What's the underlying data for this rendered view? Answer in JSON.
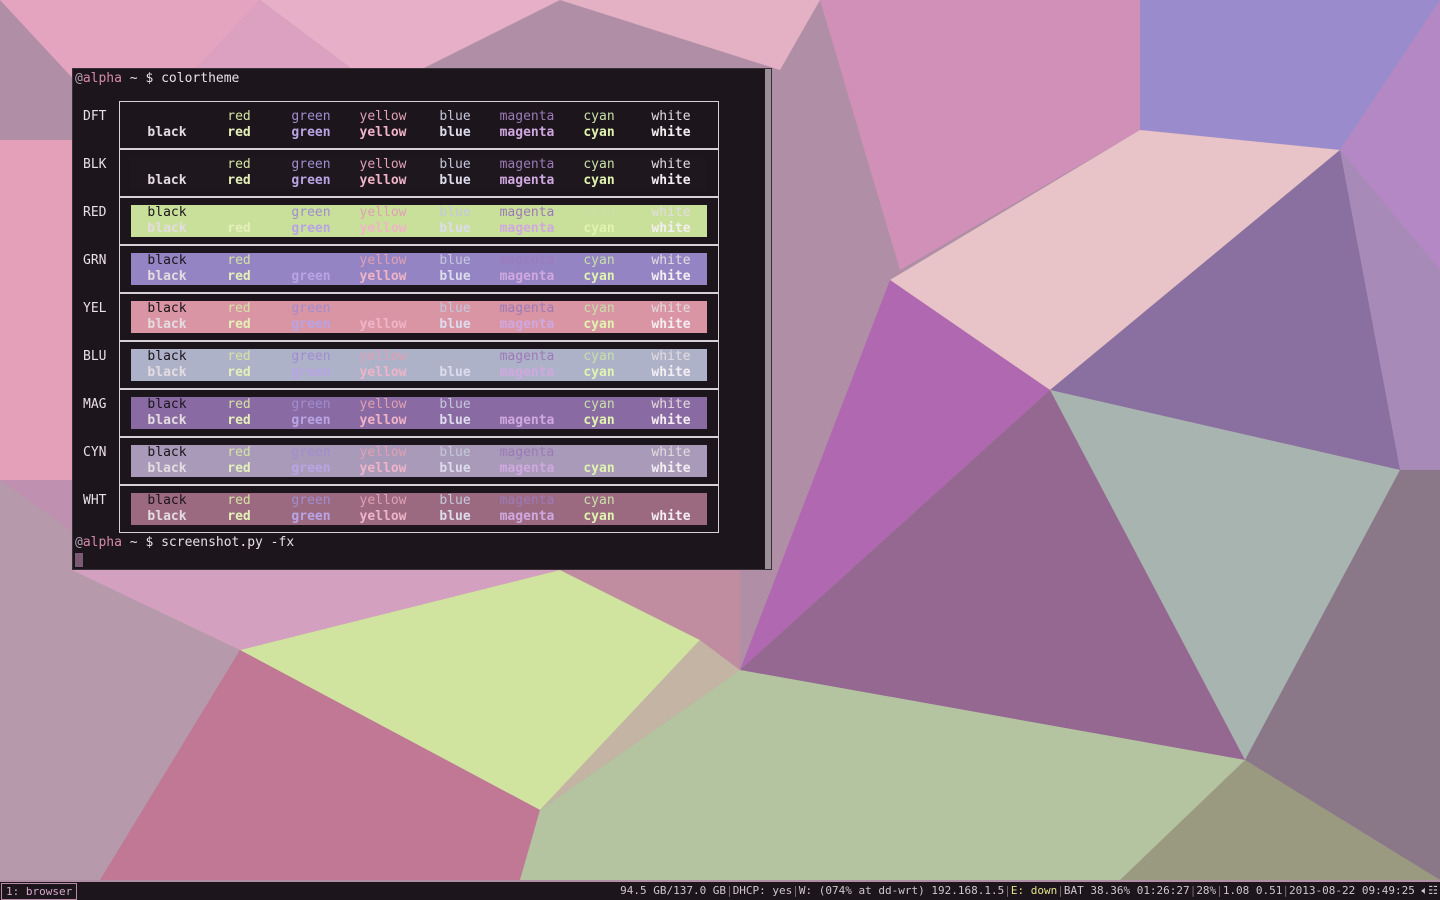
{
  "terminal": {
    "prompt1": {
      "user": "@",
      "host": "alpha",
      "path": " ~ $ ",
      "command": "colortheme"
    },
    "prompt2": {
      "user": "@",
      "host": "alpha",
      "path": " ~ $ ",
      "command": "screenshot.py -fx"
    },
    "columns": [
      "black",
      "red",
      "green",
      "yellow",
      "blue",
      "magenta",
      "cyan",
      "white"
    ],
    "rows": [
      {
        "label": "DFT",
        "bg": "transparent",
        "top": [
          "",
          "red",
          "green",
          "yellow",
          "blue",
          "magenta",
          "cyan",
          "white"
        ],
        "bottom": [
          "black",
          "red",
          "green",
          "yellow",
          "blue",
          "magenta",
          "cyan",
          "white"
        ]
      },
      {
        "label": "BLK",
        "bg": "#1e181e",
        "top": [
          "",
          "red",
          "green",
          "yellow",
          "blue",
          "magenta",
          "cyan",
          "white"
        ],
        "bottom": [
          "black",
          "red",
          "green",
          "yellow",
          "blue",
          "magenta",
          "cyan",
          "white"
        ]
      },
      {
        "label": "RED",
        "bg": "#c9e09a",
        "top": [
          "black",
          "",
          "green",
          "yellow",
          "blue",
          "magenta",
          "cyan",
          "white"
        ],
        "bottom": [
          "black",
          "red",
          "green",
          "yellow",
          "blue",
          "magenta",
          "cyan",
          "white"
        ]
      },
      {
        "label": "GRN",
        "bg": "#9484c4",
        "top": [
          "black",
          "red",
          "",
          "yellow",
          "blue",
          "magenta",
          "cyan",
          "white"
        ],
        "bottom": [
          "black",
          "red",
          "green",
          "yellow",
          "blue",
          "magenta",
          "cyan",
          "white"
        ]
      },
      {
        "label": "YEL",
        "bg": "#d995a4",
        "top": [
          "black",
          "red",
          "green",
          "",
          "blue",
          "magenta",
          "cyan",
          "white"
        ],
        "bottom": [
          "black",
          "red",
          "green",
          "yellow",
          "blue",
          "magenta",
          "cyan",
          "white"
        ]
      },
      {
        "label": "BLU",
        "bg": "#aeb2c8",
        "top": [
          "black",
          "red",
          "green",
          "yellow",
          "",
          "magenta",
          "cyan",
          "white"
        ],
        "bottom": [
          "black",
          "red",
          "green",
          "yellow",
          "blue",
          "magenta",
          "cyan",
          "white"
        ]
      },
      {
        "label": "MAG",
        "bg": "#8a6aa2",
        "top": [
          "black",
          "red",
          "green",
          "yellow",
          "blue",
          "",
          "cyan",
          "white"
        ],
        "bottom": [
          "black",
          "red",
          "green",
          "yellow",
          "blue",
          "magenta",
          "cyan",
          "white"
        ]
      },
      {
        "label": "CYN",
        "bg": "#a89ab8",
        "top": [
          "black",
          "red",
          "green",
          "yellow",
          "blue",
          "magenta",
          "",
          "white"
        ],
        "bottom": [
          "black",
          "red",
          "green",
          "yellow",
          "blue",
          "magenta",
          "cyan",
          "white"
        ]
      },
      {
        "label": "WHT",
        "bg": "#9c6a80",
        "top": [
          "black",
          "red",
          "green",
          "yellow",
          "blue",
          "magenta",
          "cyan",
          ""
        ],
        "bottom": [
          "black",
          "red",
          "green",
          "yellow",
          "blue",
          "magenta",
          "cyan",
          "white"
        ]
      }
    ],
    "fg_colors": {
      "black": "#1a141a",
      "red": "#d4e4a4",
      "green": "#a08cd0",
      "yellow": "#e0a0b4",
      "blue": "#c4c8dc",
      "magenta": "#9c7ab8",
      "cyan": "#c8e0a8",
      "white": "#e4dce0"
    },
    "fg_colors_bold": {
      "black": "#e4dce0",
      "red": "#e4f0b8",
      "green": "#b8a4e4",
      "yellow": "#f0b4c8",
      "blue": "#dcdcec",
      "magenta": "#d0a8e0",
      "cyan": "#e0f4b0",
      "white": "#f4eef2"
    }
  },
  "statusbar": {
    "workspace": "1: browser",
    "disk": "94.5 GB/137.0 GB",
    "dhcp": "DHCP: yes",
    "wifi": "W: (074% at dd-wrt) 192.168.1.5",
    "ethernet": "E: down",
    "battery": "BAT 38.36% 01:26:27",
    "volume": "28%",
    "load": "1.08 0.51",
    "datetime": "2013-08-22 09:49:25"
  }
}
